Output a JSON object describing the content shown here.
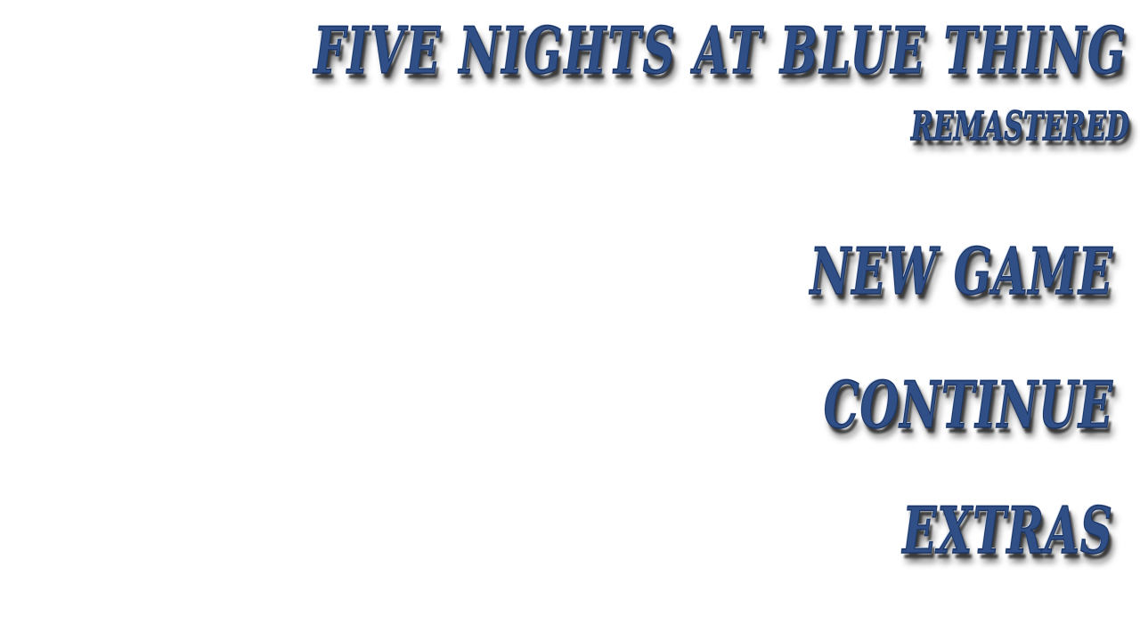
{
  "title": "FIVE NIGHTS AT BLUE THING",
  "subtitle": "REMASTERED",
  "menu": {
    "new_game": "NEW GAME",
    "continue": "CONTINUE",
    "extras": "EXTRAS"
  },
  "colors": {
    "text": "#2f4f86",
    "background": "#ffffff"
  }
}
